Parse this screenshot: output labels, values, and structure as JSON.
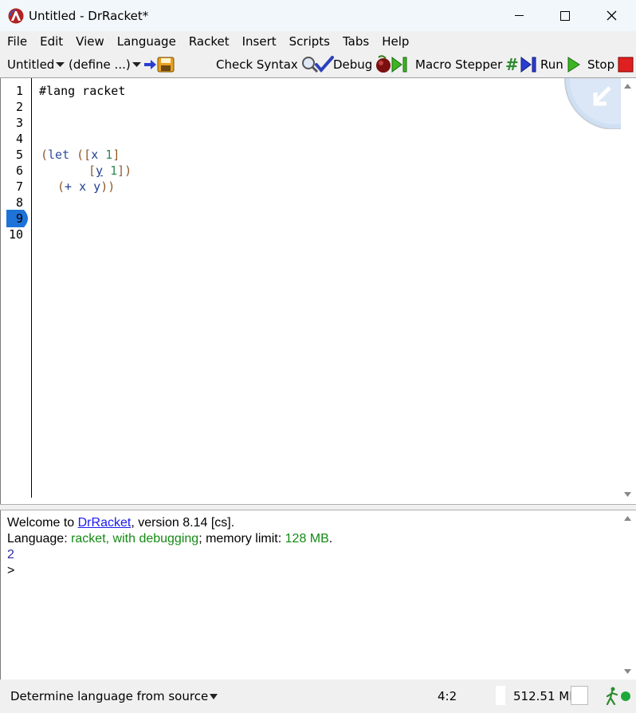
{
  "window": {
    "title": "Untitled - DrRacket*",
    "minimize": "—",
    "maximize": "☐",
    "close": "✕"
  },
  "menu": [
    "File",
    "Edit",
    "View",
    "Language",
    "Racket",
    "Insert",
    "Scripts",
    "Tabs",
    "Help"
  ],
  "toolbar": {
    "file_label": "Untitled",
    "define_label": "(define ...)",
    "check_syntax": "Check Syntax",
    "debug": "Debug",
    "macro_stepper": "Macro Stepper",
    "run": "Run",
    "stop": "Stop"
  },
  "editor": {
    "line_numbers": [
      "1",
      "2",
      "3",
      "4",
      "5",
      "6",
      "7",
      "8",
      "9",
      "10"
    ],
    "current_line": "9",
    "code": {
      "lang": "#lang racket",
      "l5_open": "(",
      "l5_let": "let",
      "l5_b": " ([",
      "l5_x": "x",
      "l5_1": "1",
      "l5_close": "]",
      "l6_b": "[",
      "l6_y": "y",
      "l6_1": "1",
      "l6_close": "])",
      "l7_open": "(",
      "l7_plus": "+",
      "l7_x": "x",
      "l7_y": "y",
      "l7_close": "))"
    }
  },
  "interactions": {
    "welcome_prefix": "Welcome to ",
    "welcome_link": "DrRacket",
    "welcome_suffix": ", version 8.14 [cs].",
    "lang_prefix": "Language: ",
    "lang_name": "racket, with debugging",
    "lang_mid": "; memory limit: ",
    "mem_limit": "128 MB",
    "lang_end": ".",
    "result": "2",
    "prompt": ">"
  },
  "status": {
    "language_selector": "Determine language from source",
    "position": "4:2",
    "memory": "512.51 MB"
  },
  "colors": {
    "accent_blue": "#1e73d8",
    "run_green": "#3cb521",
    "stop_red": "#e02020"
  }
}
